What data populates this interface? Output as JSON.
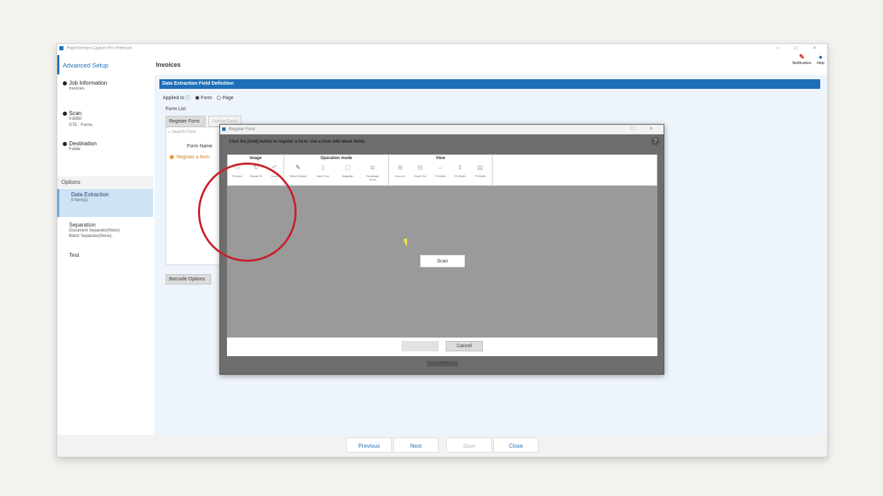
{
  "window": {
    "title": "PaperStream Capture Pro Premium",
    "controls": "– □ ×"
  },
  "sidebar": {
    "header": "Advanced Setup",
    "steps": [
      {
        "label": "Job Information",
        "sub": [
          "Invoices"
        ]
      },
      {
        "label": "Scan",
        "sub": [
          "fi-8950",
          "DTE : Forms"
        ]
      },
      {
        "label": "Destination",
        "sub": [
          "Folder"
        ]
      }
    ],
    "options_header": "Options",
    "options": [
      {
        "label": "Data Extraction",
        "sub": [
          "0 form(s)"
        ]
      },
      {
        "label": "Separation",
        "sub": [
          "Document Separator(None)",
          "Batch Separator(None)"
        ]
      },
      {
        "label": "Test",
        "sub": []
      }
    ]
  },
  "content": {
    "title": "Invoices",
    "notification_label": "Notification",
    "help_label": "Help",
    "section_bar": "Data Extraction Field Definition",
    "applied_to_label": "Applied to",
    "applied_form": "Form",
    "applied_page": "Page",
    "form_list_label": "Form List",
    "register_form_tab": "Register Form",
    "define_field_tab": "Define Field",
    "search_placeholder": "Search Form",
    "form_name_header": "Form Name",
    "register_item": "Register a form",
    "barcode_button": "Barcode Options"
  },
  "footer": {
    "previous": "Previous",
    "next": "Next",
    "save": "Save",
    "close": "Close"
  },
  "modal": {
    "title": "Register Form",
    "controls": "□ ×",
    "instruction": "Click the [Add] button to register a form. Use a form with blank fields.",
    "groups": {
      "image": {
        "title": "Image",
        "buttons": [
          "Preview",
          "Rotate 90",
          "Undo"
        ]
      },
      "operation": {
        "title": "Operation mode",
        "buttons": [
          "Select Extract",
          "Hand Tool",
          "Magnifier",
          "Rectangle Zoom"
        ]
      },
      "view": {
        "title": "View",
        "buttons": [
          "Zoom In",
          "Zoom Out",
          "Fit Width",
          "Fit Width",
          "Fit Width"
        ]
      }
    },
    "scan_button": "Scan",
    "ok_button": "",
    "cancel_button": "Cancel",
    "status": "100%"
  }
}
